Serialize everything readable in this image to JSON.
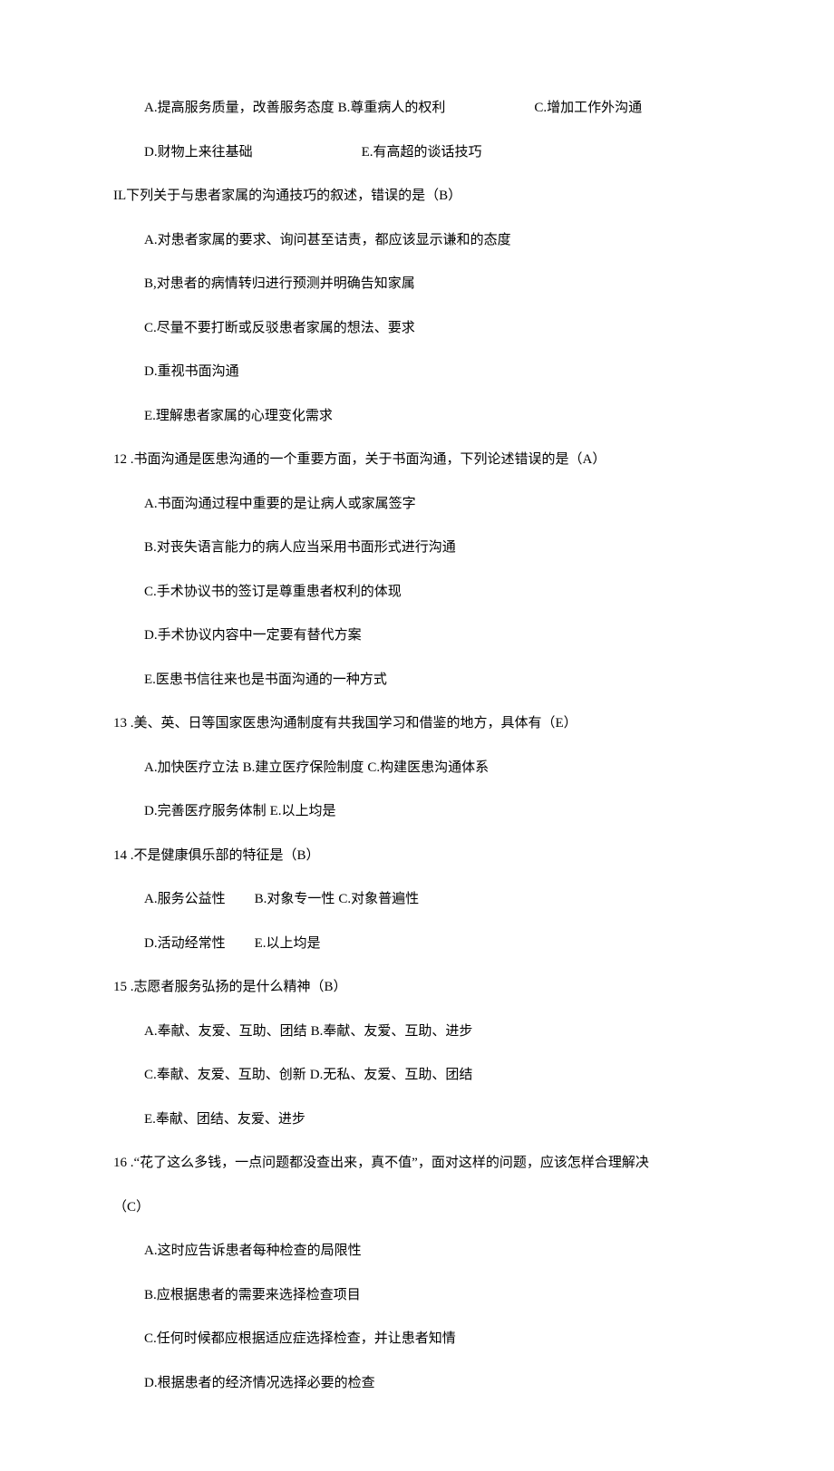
{
  "leadOptions": {
    "a": "A.提高服务质量，改善服务态度",
    "b": "B.尊重病人的权利",
    "c": "C.增加工作外沟通",
    "d": "D.财物上来往基础",
    "e": "E.有高超的谈话技巧"
  },
  "q11": {
    "stem": "IL下列关于与患者家属的沟通技巧的叙述，错误的是（B）",
    "a": "A.对患者家属的要求、询问甚至诘责，都应该显示谦和的态度",
    "b": "B,对患者的病情转归进行预测并明确告知家属",
    "c": "C.尽量不要打断或反驳患者家属的想法、要求",
    "d": "D.重视书面沟通",
    "e": "E.理解患者家属的心理变化需求"
  },
  "q12": {
    "stem": "12 .书面沟通是医患沟通的一个重要方面，关于书面沟通，下列论述错误的是（A）",
    "a": "A.书面沟通过程中重要的是让病人或家属签字",
    "b": "B.对丧失语言能力的病人应当采用书面形式进行沟通",
    "c": "C.手术协议书的签订是尊重患者权利的体现",
    "d": "D.手术协议内容中一定要有替代方案",
    "e": "E.医患书信往来也是书面沟通的一种方式"
  },
  "q13": {
    "stem": "13 .美、英、日等国家医患沟通制度有共我国学习和借鉴的地方，具体有（E）",
    "a": "A.加快医疗立法",
    "b": "B.建立医疗保险制度",
    "c": "C.构建医患沟通体系",
    "d": "D.完善医疗服务体制",
    "e": "E.以上均是"
  },
  "q14": {
    "stem": "14 .不是健康俱乐部的特征是（B）",
    "a": "A.服务公益性",
    "b": "B.对象专一性",
    "c": "C.对象普遍性",
    "d": "D.活动经常性",
    "e": "E.以上均是"
  },
  "q15": {
    "stem": "15 .志愿者服务弘扬的是什么精神（B）",
    "a": "A.奉献、友爱、互助、团结",
    "b": "B.奉献、友爱、互助、进步",
    "c": "C.奉献、友爱、互助、创新",
    "d": "D.无私、友爱、互助、团结",
    "e": "E.奉献、团结、友爱、进步"
  },
  "q16": {
    "stem1": "16 .“花了这么多钱，一点问题都没查出来，真不值”，面对这样的问题，应该怎样合理解决",
    "stem2": "（C）",
    "a": "A.这时应告诉患者每种检查的局限性",
    "b": "B.应根据患者的需要来选择检查项目",
    "c": "C.任何时候都应根据适应症选择检查，并让患者知情",
    "d": "D.根据患者的经济情况选择必要的检查"
  }
}
